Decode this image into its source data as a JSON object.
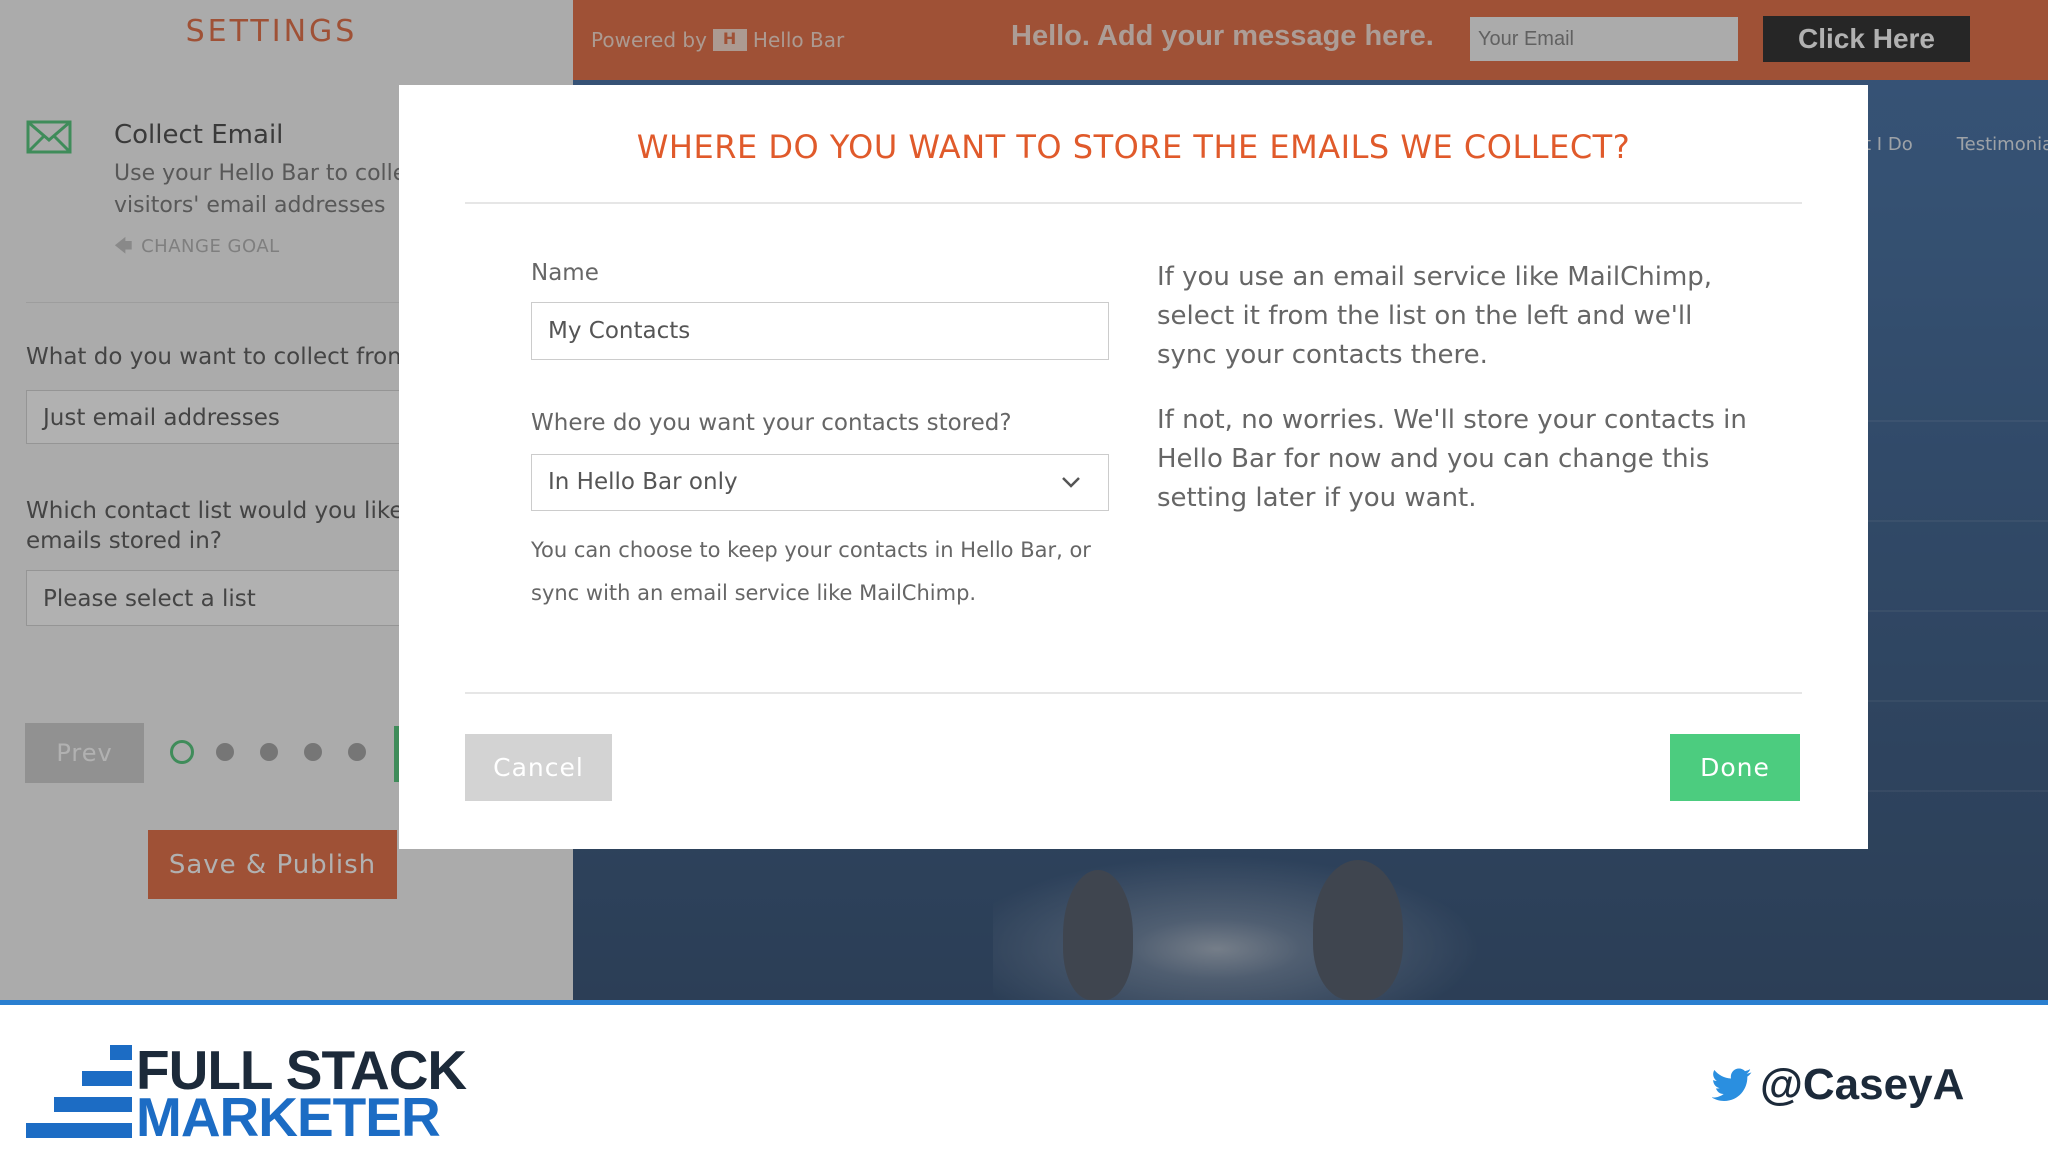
{
  "settings": {
    "title": "SETTINGS",
    "goal": {
      "title": "Collect Email",
      "description_line1": "Use your Hello Bar to collec",
      "description_line2": "visitors' email addresses",
      "change_goal": "CHANGE GOAL"
    },
    "collect_question": "What do you want to collect from",
    "collect_value": "Just email addresses",
    "list_question_line1": "Which contact list would you like y",
    "list_question_line2": "emails stored in?",
    "list_value": "Please select a list",
    "prev_label": "Prev",
    "publish_label": "Save & Publish"
  },
  "hellobar": {
    "powered_prefix": "Powered by",
    "powered_brand": "Hello Bar",
    "message": "Hello. Add your message here.",
    "email_placeholder": "Your Email",
    "cta_label": "Click Here"
  },
  "preview": {
    "nav_items": [
      "at I Do",
      "Testimonia"
    ]
  },
  "modal": {
    "title": "WHERE DO YOU WANT TO STORE THE EMAILS WE COLLECT?",
    "name_label": "Name",
    "name_value": "My Contacts",
    "store_label": "Where do you want your contacts stored?",
    "store_value": "In Hello Bar only",
    "help_text": "You can choose to keep your contacts in Hello Bar, or sync with an email service like MailChimp.",
    "info_paragraph_1": "If you use an email service like MailChimp, select it from the list on the left and we'll sync your contacts there.",
    "info_paragraph_2": "If not, no worries. We'll store your contacts in Hello Bar for now and you can change this setting later if you want.",
    "cancel_label": "Cancel",
    "done_label": "Done"
  },
  "footer": {
    "brand_line1": "FULL STACK",
    "brand_line2": "MARKETER",
    "twitter_handle": "@CaseyA"
  },
  "colors": {
    "accent": "#e05a2b",
    "success": "#4ccc7f",
    "brand_blue": "#1c6cc4"
  },
  "icons": {
    "goal": "envelope-icon",
    "change_goal": "arrow-left-icon",
    "select": "chevron-down-icon",
    "social": "twitter-bird-icon"
  }
}
